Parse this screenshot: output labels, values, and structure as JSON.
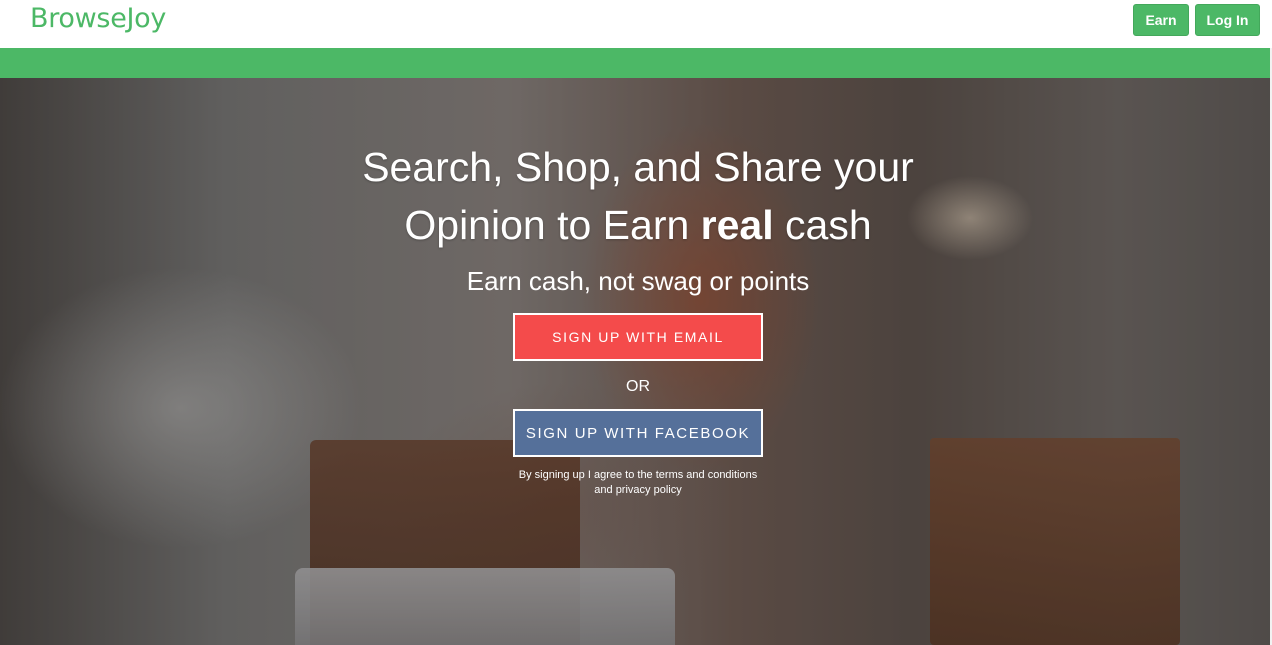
{
  "navbar": {
    "logo": "BrowseJoy",
    "earn_label": "Earn",
    "login_label": "Log In"
  },
  "hero": {
    "headline_line1": "Search, Shop, and Share your",
    "headline_line2_pre": "Opinion to Earn ",
    "headline_line2_bold": "real",
    "headline_line2_post": " cash",
    "subhead": "Earn cash, not swag or points",
    "email_button": "SIGN UP WITH EMAIL",
    "or_text": "OR",
    "facebook_button": "SIGN UP WITH FACEBOOK",
    "terms_prefix": "By signing up I agree to the ",
    "terms_link": "terms and conditions",
    "terms_middle": " and ",
    "privacy_link": "privacy policy"
  },
  "colors": {
    "brand_green": "#4cb866",
    "email_button": "#f44b4b",
    "facebook_button": "#55709a"
  }
}
